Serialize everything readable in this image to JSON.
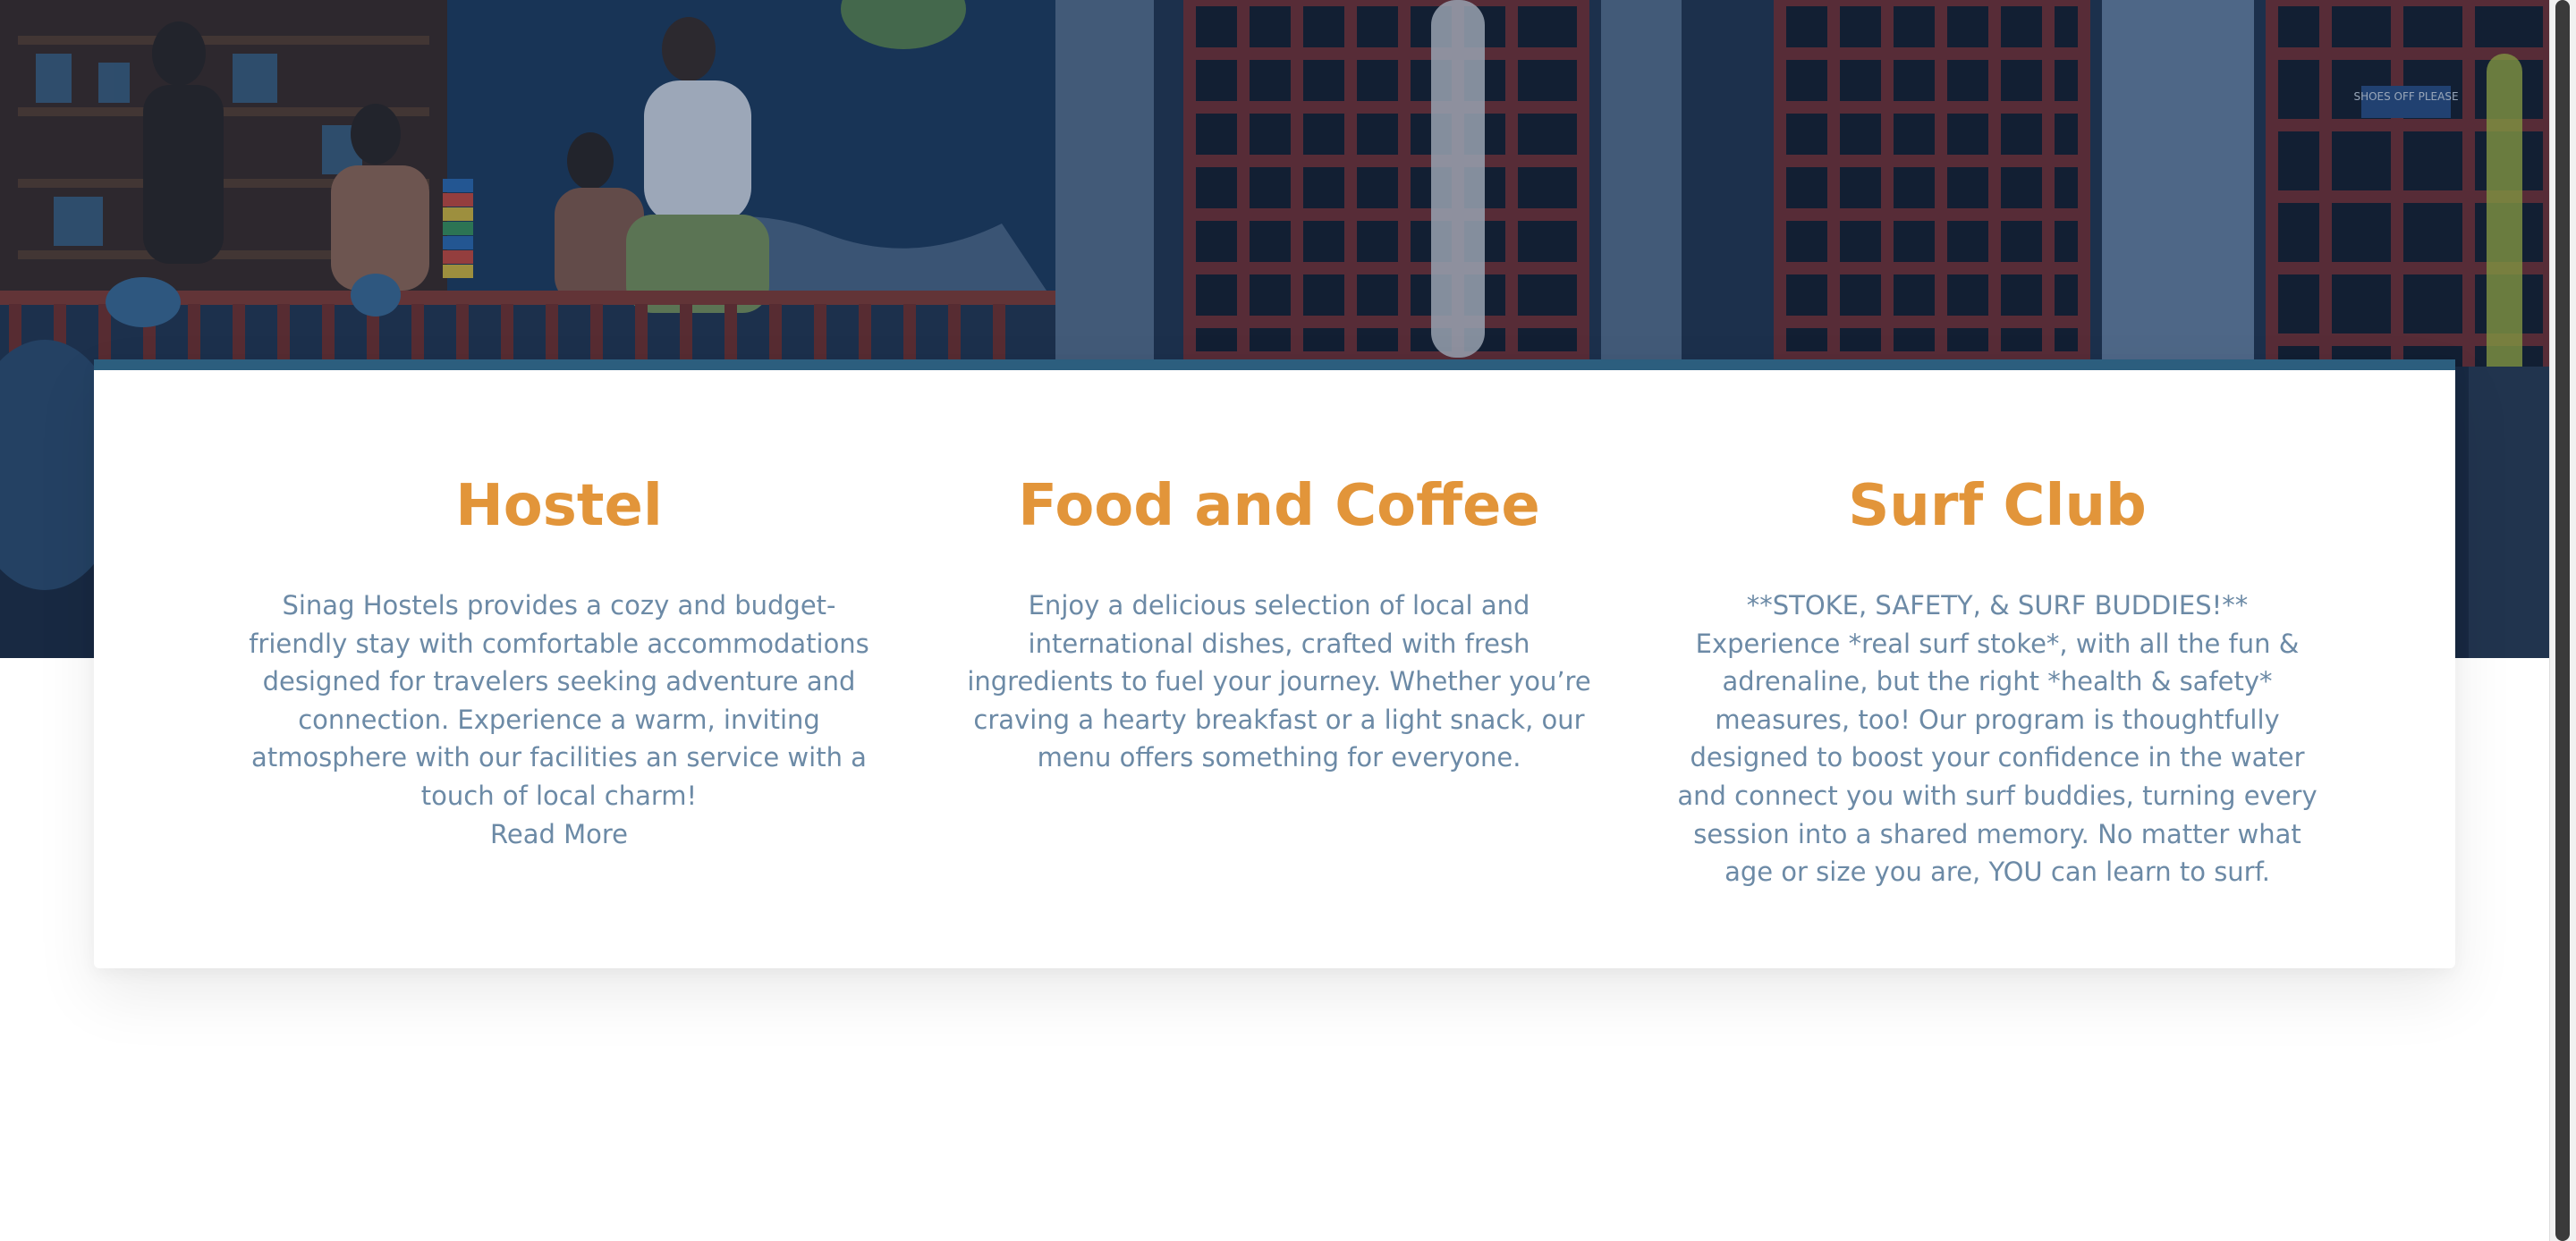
{
  "hero": {
    "photo_description_label": "hostel-porch-photo",
    "sign_text": "SHOES OFF PLEASE"
  },
  "features": [
    {
      "title": "Hostel",
      "text": "Sinag Hostels provides a cozy and budget-friendly stay with comfortable accommodations designed for travelers seeking adventure and connection. Experience a warm, inviting atmosphere with our facilities an service with a touch of local charm!",
      "link_label": "Read More"
    },
    {
      "title": "Food and Coffee",
      "text": "Enjoy a delicious selection of local and international dishes, crafted with fresh ingredients to fuel your journey. Whether you’re craving a hearty breakfast or a light snack, our menu offers something for everyone."
    },
    {
      "title": "Surf Club",
      "text": "**STOKE, SAFETY, & SURF BUDDIES!** Experience *real surf stoke*, with all the fun & adrenaline, but the right *health & safety* measures, too! Our program is thoughtfully designed to boost your confidence in the water and connect you with surf buddies, turning every session into a shared memory. No matter what age or size you are, YOU can learn to surf."
    }
  ],
  "colors": {
    "title": "#e2953a",
    "body_text": "#6c8aa6",
    "card_accent": "#2c5e7e"
  }
}
